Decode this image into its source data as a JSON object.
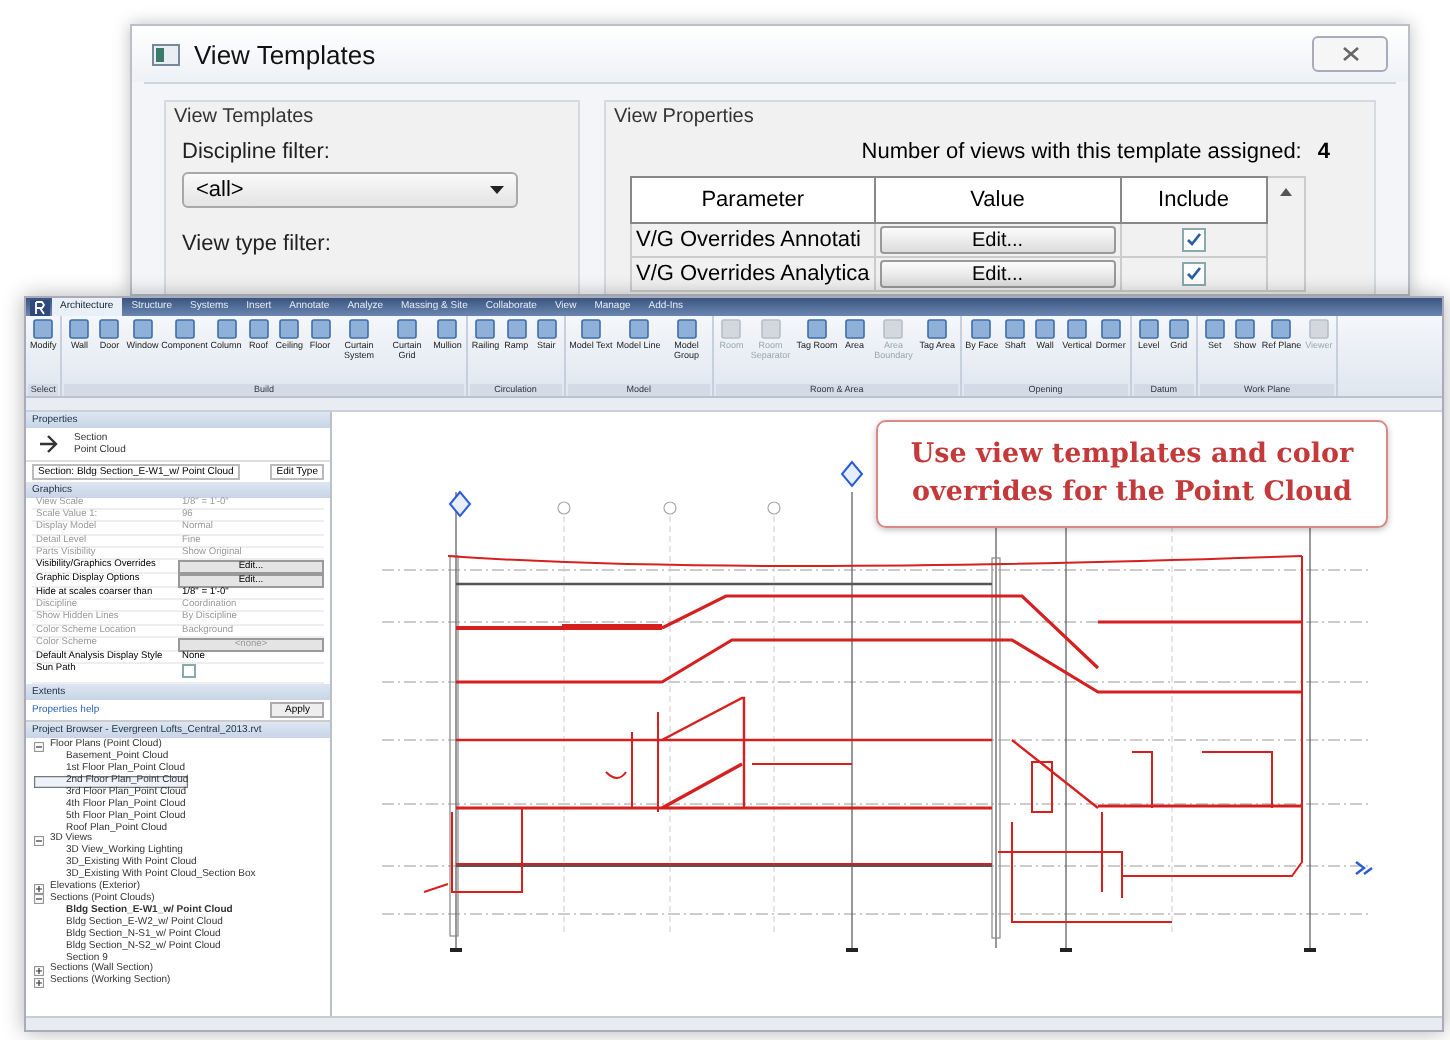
{
  "dialog": {
    "title": "View Templates",
    "templates_group": {
      "title": "View Templates",
      "discipline_label": "Discipline filter:",
      "discipline_value": "<all>",
      "view_type_label": "View type filter:"
    },
    "properties_group": {
      "title": "View Properties",
      "count_label": "Number of views with this template assigned:",
      "count": "4",
      "columns": [
        "Parameter",
        "Value",
        "Include"
      ],
      "rows": [
        {
          "parameter": "V/G Overrides Annotati",
          "value": "Edit...",
          "checked": true
        },
        {
          "parameter": "V/G Overrides Analytica",
          "value": "Edit...",
          "checked": true
        }
      ]
    }
  },
  "revit": {
    "tabs": [
      {
        "label": "Architecture",
        "selected": true
      },
      {
        "label": "Structure",
        "selected": false
      },
      {
        "label": "Systems",
        "selected": false
      },
      {
        "label": "Insert",
        "selected": false
      },
      {
        "label": "Annotate",
        "selected": false
      },
      {
        "label": "Analyze",
        "selected": false
      },
      {
        "label": "Massing & Site",
        "selected": false
      },
      {
        "label": "Collaborate",
        "selected": false
      },
      {
        "label": "View",
        "selected": false
      },
      {
        "label": "Manage",
        "selected": false
      },
      {
        "label": "Add-Ins",
        "selected": false
      }
    ],
    "panels": [
      {
        "label": "Select",
        "tools": [
          {
            "label": "Modify",
            "disabled": false
          }
        ]
      },
      {
        "label": "Build",
        "tools": [
          {
            "label": "Wall",
            "disabled": false
          },
          {
            "label": "Door",
            "disabled": false
          },
          {
            "label": "Window",
            "disabled": false
          },
          {
            "label": "Component",
            "disabled": false
          },
          {
            "label": "Column",
            "disabled": false
          },
          {
            "label": "Roof",
            "disabled": false
          },
          {
            "label": "Ceiling",
            "disabled": false
          },
          {
            "label": "Floor",
            "disabled": false
          },
          {
            "label": "Curtain System",
            "disabled": false
          },
          {
            "label": "Curtain Grid",
            "disabled": false
          },
          {
            "label": "Mullion",
            "disabled": false
          }
        ]
      },
      {
        "label": "Circulation",
        "tools": [
          {
            "label": "Railing",
            "disabled": false
          },
          {
            "label": "Ramp",
            "disabled": false
          },
          {
            "label": "Stair",
            "disabled": false
          }
        ]
      },
      {
        "label": "Model",
        "tools": [
          {
            "label": "Model Text",
            "disabled": false
          },
          {
            "label": "Model Line",
            "disabled": false
          },
          {
            "label": "Model Group",
            "disabled": false
          }
        ]
      },
      {
        "label": "Room & Area",
        "tools": [
          {
            "label": "Room",
            "disabled": true
          },
          {
            "label": "Room Separator",
            "disabled": true
          },
          {
            "label": "Tag Room",
            "disabled": false
          },
          {
            "label": "Area",
            "disabled": false
          },
          {
            "label": "Area Boundary",
            "disabled": true
          },
          {
            "label": "Tag Area",
            "disabled": false
          }
        ]
      },
      {
        "label": "Opening",
        "tools": [
          {
            "label": "By Face",
            "disabled": false
          },
          {
            "label": "Shaft",
            "disabled": false
          },
          {
            "label": "Wall",
            "disabled": false
          },
          {
            "label": "Vertical",
            "disabled": false
          },
          {
            "label": "Dormer",
            "disabled": false
          }
        ]
      },
      {
        "label": "Datum",
        "tools": [
          {
            "label": "Level",
            "disabled": false
          },
          {
            "label": "Grid",
            "disabled": false
          }
        ]
      },
      {
        "label": "Work Plane",
        "tools": [
          {
            "label": "Set",
            "disabled": false
          },
          {
            "label": "Show",
            "disabled": false
          },
          {
            "label": "Ref Plane",
            "disabled": false
          },
          {
            "label": "Viewer",
            "disabled": true
          }
        ]
      }
    ],
    "properties": {
      "title": "Properties",
      "type_name": "Section",
      "type_sub": "Point Cloud",
      "instance": "Section: Bldg Section_E-W1_w/ Point Cloud",
      "edit_type": "Edit Type",
      "section": "Graphics",
      "rows": [
        {
          "name": "View Scale",
          "value": "1/8\" = 1'-0\"",
          "kind": "text",
          "disabled": true
        },
        {
          "name": "Scale Value 1:",
          "value": "96",
          "kind": "text",
          "disabled": true
        },
        {
          "name": "Display Model",
          "value": "Normal",
          "kind": "text",
          "disabled": true
        },
        {
          "name": "Detail Level",
          "value": "Fine",
          "kind": "text",
          "disabled": true
        },
        {
          "name": "Parts Visibility",
          "value": "Show Original",
          "kind": "text",
          "disabled": true
        },
        {
          "name": "Visibility/Graphics Overrides",
          "value": "Edit...",
          "kind": "button",
          "disabled": false
        },
        {
          "name": "Graphic Display Options",
          "value": "Edit...",
          "kind": "button",
          "disabled": false
        },
        {
          "name": "Hide at scales coarser than",
          "value": "1/8\" = 1'-0\"",
          "kind": "text",
          "disabled": false
        },
        {
          "name": "Discipline",
          "value": "Coordination",
          "kind": "text",
          "disabled": true
        },
        {
          "name": "Show Hidden Lines",
          "value": "By Discipline",
          "kind": "text",
          "disabled": true
        },
        {
          "name": "Color Scheme Location",
          "value": "Background",
          "kind": "text",
          "disabled": true
        },
        {
          "name": "Color Scheme",
          "value": "<none>",
          "kind": "button",
          "disabled": true
        },
        {
          "name": "Default Analysis Display Style",
          "value": "None",
          "kind": "text",
          "disabled": false
        },
        {
          "name": "Sun Path",
          "checked": false,
          "kind": "checkbox",
          "disabled": false
        }
      ],
      "extents": "Extents",
      "help": "Properties help",
      "apply": "Apply"
    },
    "browser": {
      "title": "Project Browser - Evergreen Lofts_Central_2013.rvt",
      "tree": [
        {
          "label": "Floor Plans (Point Cloud)",
          "expanded": true,
          "children": [
            {
              "label": "Basement_Point Cloud",
              "selected": false,
              "current": false
            },
            {
              "label": "1st Floor Plan_Point Cloud",
              "selected": false,
              "current": false
            },
            {
              "label": "2nd Floor Plan_Point Cloud",
              "selected": true,
              "current": false
            },
            {
              "label": "3rd Floor Plan_Point Cloud",
              "selected": false,
              "current": false
            },
            {
              "label": "4th Floor Plan_Point Cloud",
              "selected": false,
              "current": false
            },
            {
              "label": "5th Floor Plan_Point Cloud",
              "selected": false,
              "current": false
            },
            {
              "label": "Roof Plan_Point Cloud",
              "selected": false,
              "current": false
            }
          ]
        },
        {
          "label": "3D Views",
          "expanded": true,
          "children": [
            {
              "label": "3D View_Working Lighting",
              "selected": false,
              "current": false
            },
            {
              "label": "3D_Existing With Point Cloud",
              "selected": false,
              "current": false
            },
            {
              "label": "3D_Existing With Point Cloud_Section Box",
              "selected": false,
              "current": false
            }
          ]
        },
        {
          "label": "Elevations (Exterior)",
          "expanded": false
        },
        {
          "label": "Sections (Point Clouds)",
          "expanded": true,
          "children": [
            {
              "label": "Bldg Section_E-W1_w/ Point Cloud",
              "selected": false,
              "current": true
            },
            {
              "label": "Bldg Section_E-W2_w/ Point Cloud",
              "selected": false,
              "current": false
            },
            {
              "label": "Bldg Section_N-S1_w/ Point Cloud",
              "selected": false,
              "current": false
            },
            {
              "label": "Bldg Section_N-S2_w/ Point Cloud",
              "selected": false,
              "current": false
            },
            {
              "label": "Section 9",
              "selected": false,
              "current": false
            }
          ]
        },
        {
          "label": "Sections (Wall Section)",
          "expanded": false
        },
        {
          "label": "Sections (Working Section)",
          "expanded": false
        }
      ]
    },
    "callout": "Use view templates and color overrides for the Point Cloud"
  }
}
